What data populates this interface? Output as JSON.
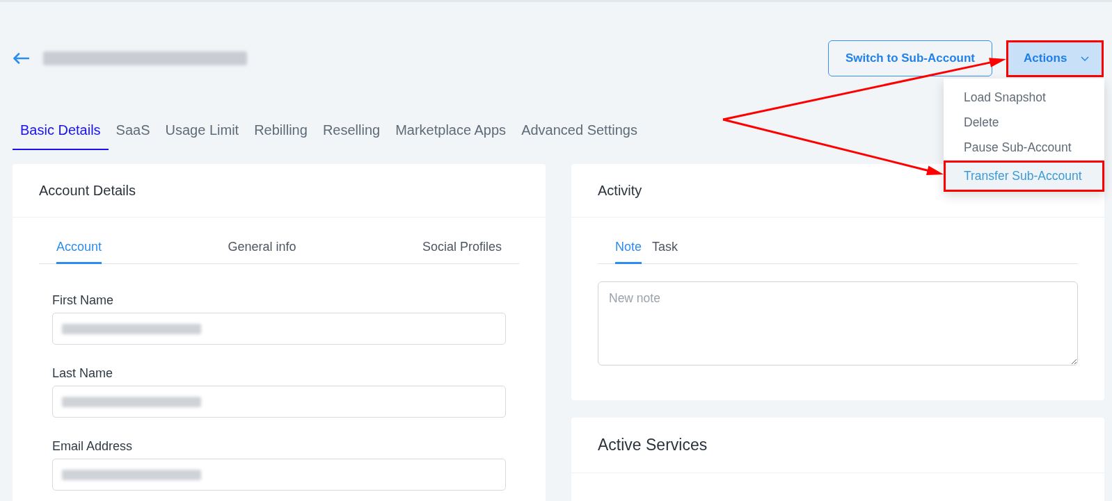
{
  "page_header": {
    "title": {
      "redacted": true
    },
    "buttons": [
      {
        "kind": "outline",
        "label": "Switch to Sub-Account",
        "highlighted": false
      },
      {
        "kind": "dropdown",
        "label": "Actions",
        "highlighted": true
      }
    ]
  },
  "actions_menu": {
    "items": [
      {
        "label": "Load Snapshot",
        "selected": false,
        "highlighted": false
      },
      {
        "label": "Delete",
        "selected": false,
        "highlighted": false
      },
      {
        "label": "Pause Sub-Account",
        "selected": false,
        "highlighted": false
      },
      {
        "label": "Transfer Sub-Account",
        "selected": true,
        "highlighted": true
      }
    ]
  },
  "tabs": [
    {
      "label": "Basic Details",
      "selected": true
    },
    {
      "label": "SaaS",
      "selected": false
    },
    {
      "label": "Usage Limit",
      "selected": false
    },
    {
      "label": "Rebilling",
      "selected": false
    },
    {
      "label": "Reselling",
      "selected": false
    },
    {
      "label": "Marketplace Apps",
      "selected": false
    },
    {
      "label": "Advanced Settings",
      "selected": false
    }
  ],
  "account_details": {
    "title": "Account Details",
    "tabs": [
      {
        "label": "Account",
        "selected": true
      },
      {
        "label": "General info",
        "selected": false
      },
      {
        "label": "Social Profiles",
        "selected": false
      }
    ],
    "fields": [
      {
        "label": "First Name",
        "redacted": true
      },
      {
        "label": "Last Name",
        "redacted": true
      },
      {
        "label": "Email Address",
        "redacted": true
      }
    ]
  },
  "activity": {
    "title": "Activity",
    "tabs": [
      {
        "label": "Note",
        "selected": true
      },
      {
        "label": "Task",
        "selected": false
      }
    ],
    "note": {
      "placeholder": "New note"
    }
  },
  "active_services": {
    "title": "Active Services"
  }
}
